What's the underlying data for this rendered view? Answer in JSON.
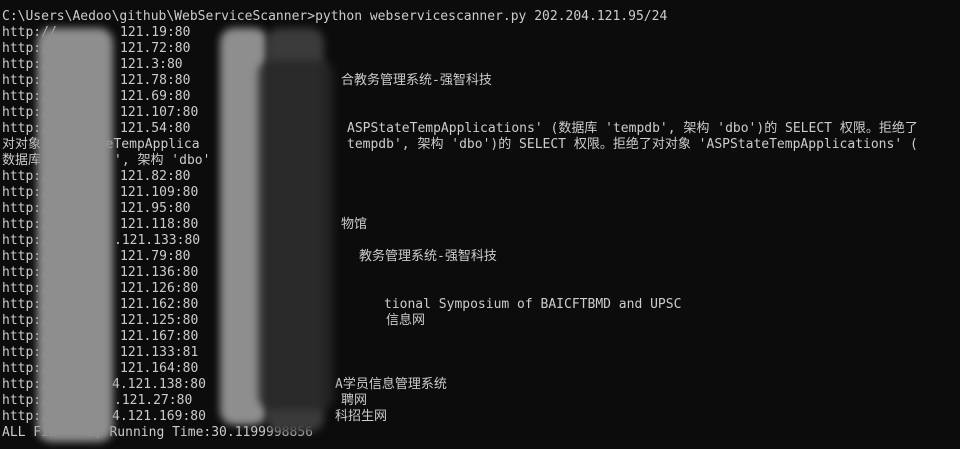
{
  "prompt": "C:\\Users\\Aedoo\\github\\WebServiceScanner>python webservicescanner.py 202.204.121.95/24",
  "rows": [
    {
      "url": "http://",
      "ip": "121.19:80",
      "title": ""
    },
    {
      "url": "http://",
      "ip": "121.72:80",
      "title": ""
    },
    {
      "url": "http:/",
      "ip": "121.3:80",
      "title": ""
    },
    {
      "url": "http:/",
      "ip": "121.78:80",
      "title": "合教务管理系统-强智科技"
    },
    {
      "url": "http:/",
      "ip": "121.69:80",
      "title": ""
    },
    {
      "url": "http://",
      "ip": "121.107:80",
      "title": ""
    },
    {
      "url": "http:/",
      "ip": "121.54:80",
      "title": "ASPStateTempApplications' (数据库 'tempdb', 架构 'dbo')的 SELECT 权限。拒绝了"
    }
  ],
  "wrap1_left": "对对象",
  "wrap1_mid": "ateTempApplica",
  "wrap1_right": "tempdb', 架构 'dbo')的 SELECT 权限。拒绝了对对象 'ASPStateTempApplications' (",
  "wrap2_left": "数据库",
  "wrap2_mid": "', 架构 'dbo'",
  "rows2": [
    {
      "url": "http://",
      "ip": "121.82:80",
      "title": ""
    },
    {
      "url": "http://",
      "ip": "121.109:80",
      "title": ""
    },
    {
      "url": "http:/",
      "ip": "121.95:80",
      "title": ""
    },
    {
      "url": "http:/",
      "ip": "121.118:80",
      "title": "物馆"
    },
    {
      "url": "http:/",
      "ip": ".121.133:80",
      "title": ""
    },
    {
      "url": "http:/",
      "ip": "121.79:80",
      "title": "教务管理系统-强智科技"
    },
    {
      "url": "http://",
      "ip": "121.136:80",
      "title": ""
    },
    {
      "url": "http:/",
      "ip": "121.126:80",
      "title": ""
    },
    {
      "url": "http:/",
      "ip": "121.162:80",
      "title": "tional Symposium of BAICFTBMD and UPSC"
    },
    {
      "url": "http:/",
      "ip": "121.125:80",
      "title": "信息网"
    },
    {
      "url": "http:/",
      "ip": "121.167:80",
      "title": ""
    },
    {
      "url": "http:/",
      "ip": "121.133:81",
      "title": ""
    },
    {
      "url": "http:/",
      "ip": "121.164:80",
      "title": ""
    },
    {
      "url": "http:/",
      "ip": "4.121.138:80",
      "title": "A学员信息管理系统"
    },
    {
      "url": "http:/",
      "ip": ".121.27:80",
      "title": "聘网"
    },
    {
      "url": "http:/",
      "ip": "4.121.169:80",
      "title": "科招生网"
    }
  ],
  "footer_left": "ALL Fin",
  "footer_right": "d, Running Time:30.1199998856"
}
